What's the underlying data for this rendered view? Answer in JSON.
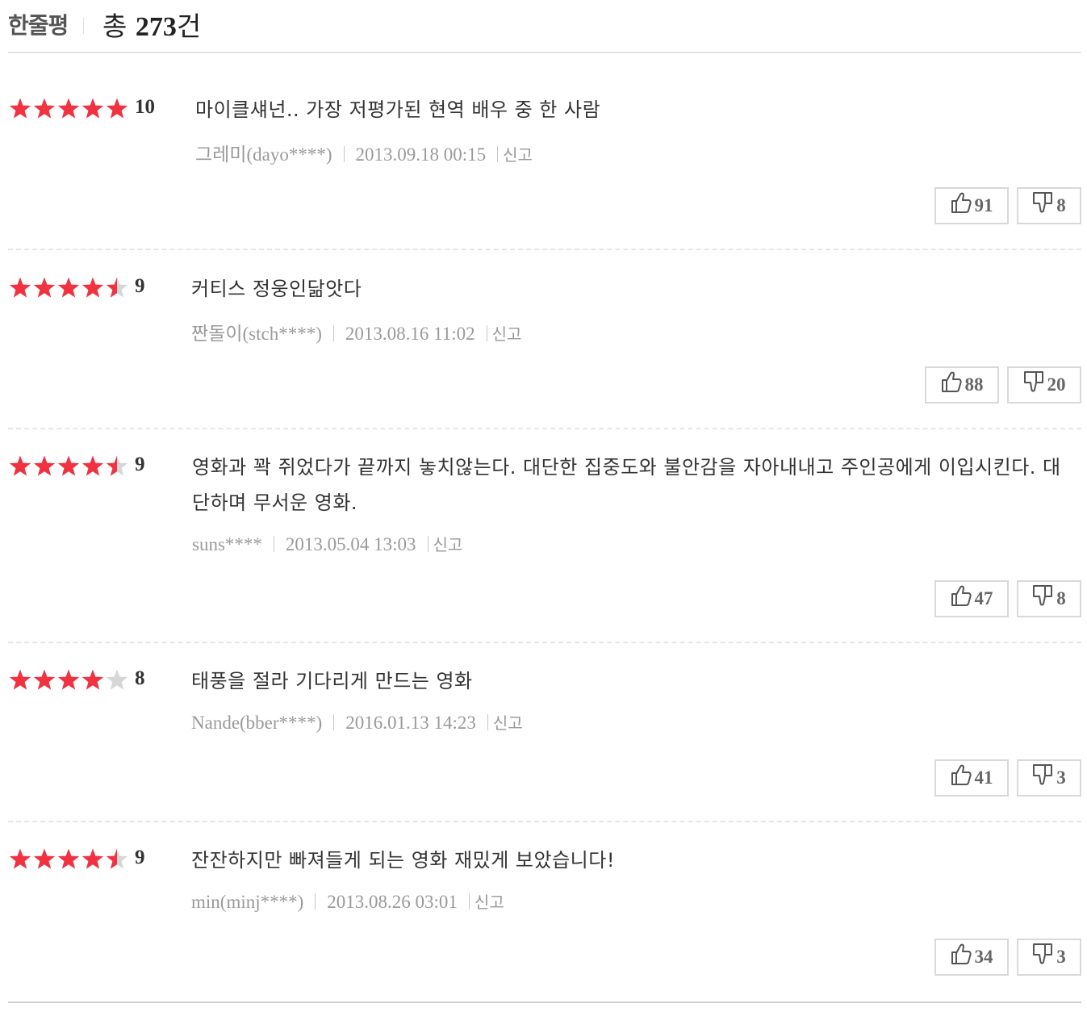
{
  "header": {
    "title": "한줄평",
    "total_prefix": "총",
    "total_count": "273",
    "total_suffix": "건"
  },
  "colors": {
    "star_on": "#f03241",
    "star_off": "#d6d6d6",
    "meta_text": "#9a9a9a",
    "divider": "#e6e6e6"
  },
  "reviews": [
    {
      "stars": 5,
      "score": "10",
      "text": "마이클섀넌.. 가장 저평가된 현역 배우 중 한 사람",
      "nick_ko": "그레미",
      "nick_id": "(dayo****)",
      "date": "2013.09.18 00:15",
      "report": "신고",
      "likes": "91",
      "dislikes": "8"
    },
    {
      "stars": 4.5,
      "score": "9",
      "text": "커티스 정웅인닮앗다",
      "nick_ko": "짠돌이",
      "nick_id": "(stch****)",
      "date": "2013.08.16 11:02",
      "report": "신고",
      "likes": "88",
      "dislikes": "20"
    },
    {
      "stars": 4.5,
      "score": "9",
      "text": "영화과 꽉 쥐었다가 끝까지 놓치않는다. 대단한 집중도와 불안감을 자아내내고 주인공에게 이입시킨다. 대단하며 무서운 영화.",
      "nick_ko": "",
      "nick_id": "suns****",
      "date": "2013.05.04 13:03",
      "report": "신고",
      "likes": "47",
      "dislikes": "8"
    },
    {
      "stars": 4,
      "score": "8",
      "text": "태풍을 절라 기다리게 만드는 영화",
      "nick_ko": "",
      "nick_id": "Nande(bber****)",
      "date": "2016.01.13 14:23",
      "report": "신고",
      "likes": "41",
      "dislikes": "3"
    },
    {
      "stars": 4.5,
      "score": "9",
      "text": "잔잔하지만 빠져들게 되는 영화 재밌게 보았습니다!",
      "nick_ko": "",
      "nick_id": "min(minj****)",
      "date": "2013.08.26 03:01",
      "report": "신고",
      "likes": "34",
      "dislikes": "3"
    }
  ]
}
